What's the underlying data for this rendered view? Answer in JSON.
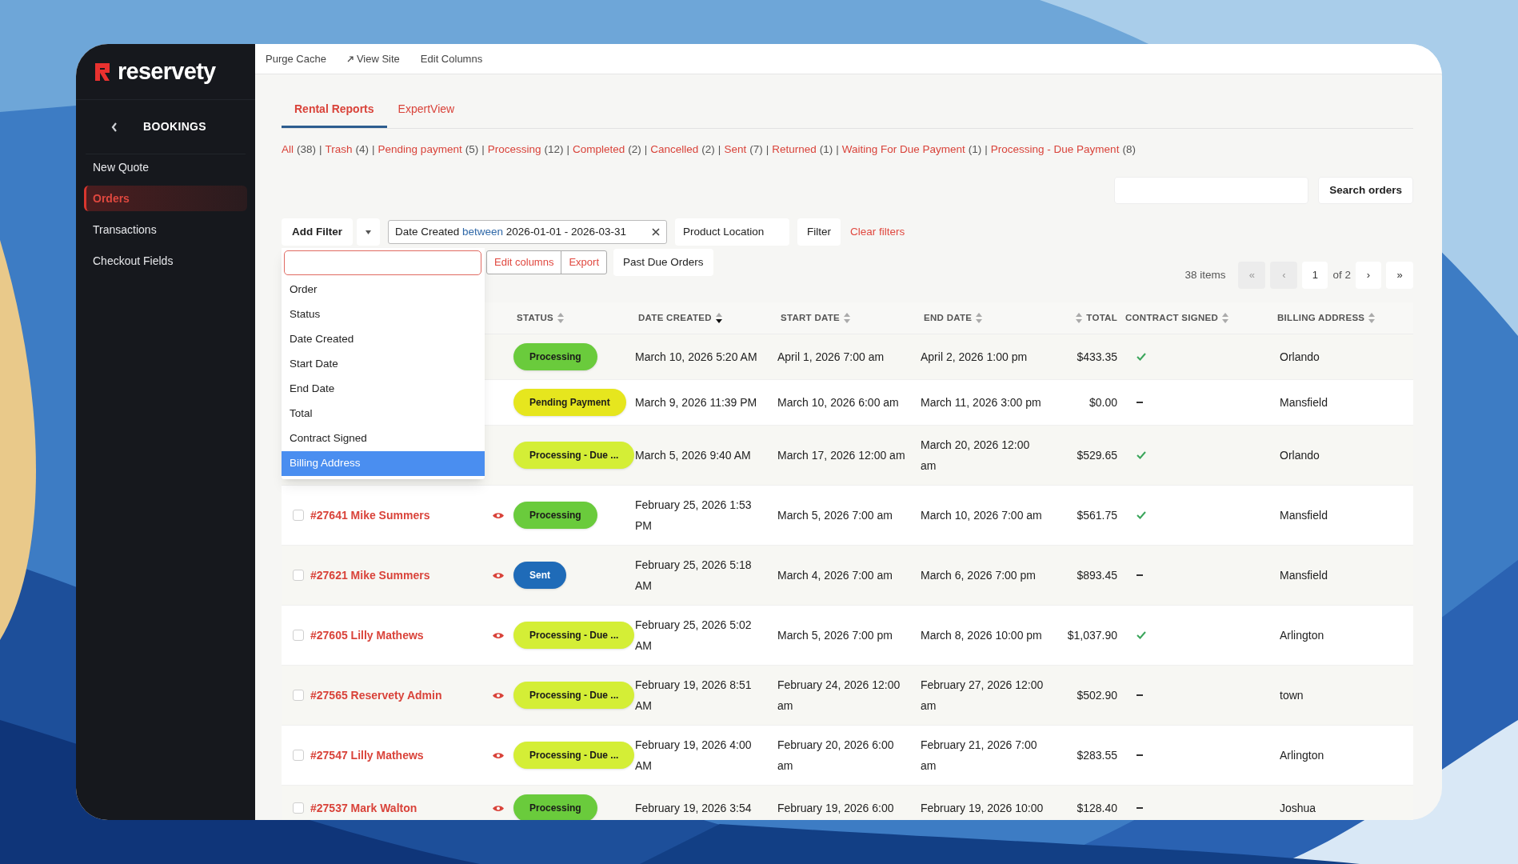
{
  "logo": {
    "text": "reservety"
  },
  "sidebar": {
    "section": "BOOKINGS",
    "items": [
      {
        "label": "New Quote",
        "selected": false
      },
      {
        "label": "Orders",
        "selected": true
      },
      {
        "label": "Transactions",
        "selected": false
      },
      {
        "label": "Checkout Fields",
        "selected": false
      }
    ]
  },
  "toolbar": [
    {
      "label": "Purge Cache",
      "kind": "plain"
    },
    {
      "label": "View Site",
      "kind": "external"
    },
    {
      "label": "Edit Columns",
      "kind": "plain"
    }
  ],
  "tabs": [
    {
      "label": "Rental Reports",
      "selected": true
    },
    {
      "label": "ExpertView",
      "selected": false
    }
  ],
  "status_filters": [
    {
      "label": "All",
      "count": "(38)"
    },
    {
      "separator": "|",
      "label": "Trash",
      "count": "(4)"
    },
    {
      "separator": "|",
      "label": "Pending payment",
      "count": "(5)"
    },
    {
      "separator": "|",
      "label": "Processing",
      "count": "(12)"
    },
    {
      "separator": "|",
      "label": "Completed",
      "count": "(2)"
    },
    {
      "separator": "|",
      "label": "Cancelled",
      "count": "(2)"
    },
    {
      "separator": "|",
      "label": "Sent",
      "count": "(7)"
    },
    {
      "separator": "|",
      "label": "Returned",
      "count": "(1)"
    },
    {
      "separator": "|",
      "label": "Waiting For Due Payment",
      "count": "(1)"
    },
    {
      "separator": "|",
      "label": "Processing - Due Payment",
      "count": "(8)"
    }
  ],
  "search": {
    "button": "Search orders"
  },
  "filters": {
    "add_filter": "Add Filter",
    "chip": {
      "field": "Date Created",
      "operator": "between",
      "value": "2026-01-01 - 2026-03-31"
    },
    "location": "Product Location",
    "filter_button": "Filter",
    "clear": "Clear filters"
  },
  "actions": [
    {
      "label": "Edit columns",
      "kind": "outline"
    },
    {
      "label": "Export",
      "kind": "outline"
    },
    {
      "label": "Past Due Orders",
      "kind": "plain"
    }
  ],
  "pagination": {
    "items": "38 items",
    "first": "«",
    "prev": "‹",
    "page": "1",
    "of": "of 2",
    "next": "›",
    "last": "»"
  },
  "dropdown": {
    "items": [
      {
        "label": "Order",
        "selected": false
      },
      {
        "label": "Status",
        "selected": false
      },
      {
        "label": "Date Created",
        "selected": false
      },
      {
        "label": "Start Date",
        "selected": false
      },
      {
        "label": "End Date",
        "selected": false
      },
      {
        "label": "Total",
        "selected": false
      },
      {
        "label": "Contract Signed",
        "selected": false
      },
      {
        "label": "Billing Address",
        "selected": true
      }
    ]
  },
  "table": {
    "columns": [
      {
        "label": "STATUS",
        "sorted": false,
        "kind": "text"
      },
      {
        "label": "DATE CREATED",
        "sorted": true,
        "kind": "text"
      },
      {
        "label": "START DATE",
        "sorted": false,
        "kind": "text"
      },
      {
        "label": "END DATE",
        "sorted": false,
        "kind": "text"
      },
      {
        "label": "TOTAL",
        "sorted": false,
        "kind": "numeric"
      },
      {
        "label": "CONTRACT SIGNED",
        "sorted": false,
        "kind": "text"
      },
      {
        "label": "BILLING ADDRESS",
        "sorted": false,
        "kind": "text"
      }
    ],
    "rows": [
      {
        "status": {
          "label": "Processing",
          "color": "#6acb3c"
        },
        "created": "March 10, 2026 5:20 AM",
        "start": "April 1, 2026 7:00 am",
        "end": "April 2, 2026 1:00 pm",
        "total": "$433.35",
        "contract_signed": true,
        "billing": "Orlando"
      },
      {
        "status": {
          "label": "Pending Payment",
          "color": "#e6e61e"
        },
        "created": "March 9, 2026 11:39 PM",
        "start": "March 10, 2026 6:00 am",
        "end": "March 11, 2026 3:00 pm",
        "total": "$0.00",
        "contract_signed": false,
        "billing": "Mansfield"
      },
      {
        "status": {
          "label": "Processing - Due ...",
          "color": "#d4ee36"
        },
        "created": "March 5, 2026 9:40 AM",
        "start": "March 17, 2026 12:00 am",
        "end": "March 20, 2026 12:00 am",
        "total": "$529.65",
        "contract_signed": true,
        "billing": "Orlando"
      },
      {
        "checked": false,
        "order": "#27641 Mike Summers",
        "status": {
          "label": "Processing",
          "color": "#6acb3c"
        },
        "created": "February 25, 2026 1:53 PM",
        "start": "March 5, 2026 7:00 am",
        "end": "March 10, 2026 7:00 am",
        "total": "$561.75",
        "contract_signed": true,
        "billing": "Mansfield"
      },
      {
        "checked": false,
        "order": "#27621 Mike Summers",
        "status": {
          "label": "Sent",
          "color": "#1f6bb8"
        },
        "created": "February 25, 2026 5:18 AM",
        "start": "March 4, 2026 7:00 am",
        "end": "March 6, 2026 7:00 pm",
        "total": "$893.45",
        "contract_signed": false,
        "billing": "Mansfield"
      },
      {
        "checked": false,
        "order": "#27605 Lilly Mathews",
        "status": {
          "label": "Processing - Due ...",
          "color": "#d4ee36"
        },
        "created": "February 25, 2026 5:02 AM",
        "start": "March 5, 2026 7:00 pm",
        "end": "March 8, 2026 10:00 pm",
        "total": "$1,037.90",
        "contract_signed": true,
        "billing": "Arlington"
      },
      {
        "checked": false,
        "order": "#27565 Reservety Admin",
        "status": {
          "label": "Processing - Due ...",
          "color": "#d4ee36"
        },
        "created": "February 19, 2026 8:51 AM",
        "start": "February 24, 2026 12:00 am",
        "end": "February 27, 2026 12:00 am",
        "total": "$502.90",
        "contract_signed": false,
        "billing": "town"
      },
      {
        "checked": false,
        "order": "#27547 Lilly Mathews",
        "status": {
          "label": "Processing - Due ...",
          "color": "#d4ee36"
        },
        "created": "February 19, 2026 4:00 AM",
        "start": "February 20, 2026 6:00 am",
        "end": "February 21, 2026 7:00 am",
        "total": "$283.55",
        "contract_signed": false,
        "billing": "Arlington"
      },
      {
        "checked": false,
        "order": "#27537 Mark Walton",
        "status": {
          "label": "Processing",
          "color": "#6acb3c"
        },
        "created": "February 19, 2026 3:54",
        "start": "February 19, 2026 6:00",
        "end": "February 19, 2026 10:00",
        "total": "$128.40",
        "contract_signed": false,
        "billing": "Joshua"
      }
    ]
  }
}
